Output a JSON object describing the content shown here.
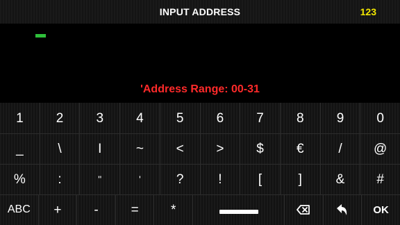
{
  "header": {
    "title": "INPUT ADDRESS",
    "mode": "123"
  },
  "input": {
    "value": ""
  },
  "hint": "'Address Range: 00-31",
  "keyboard": {
    "row1": [
      "1",
      "2",
      "3",
      "4",
      "5",
      "6",
      "7",
      "8",
      "9",
      "0"
    ],
    "row2": [
      "_",
      "\\",
      "I",
      "~",
      "<",
      ">",
      "$",
      "€",
      "/",
      "@"
    ],
    "row3": [
      "%",
      ":",
      "\"",
      "'",
      "?",
      "!",
      "[",
      "]",
      "&",
      "#"
    ],
    "row4": {
      "abc": "ABC",
      "plus": "+",
      "minus": "-",
      "equals": "=",
      "asterisk": "*",
      "space_icon": "space-bar-icon",
      "backspace_icon": "backspace-icon",
      "return_icon": "return-arrow-icon",
      "ok": "OK"
    }
  },
  "colors": {
    "title": "#ffffff",
    "mode": "#f2e600",
    "cursor": "#2fbf3a",
    "hint": "#ff2a2a",
    "key_text": "#ffffff"
  }
}
